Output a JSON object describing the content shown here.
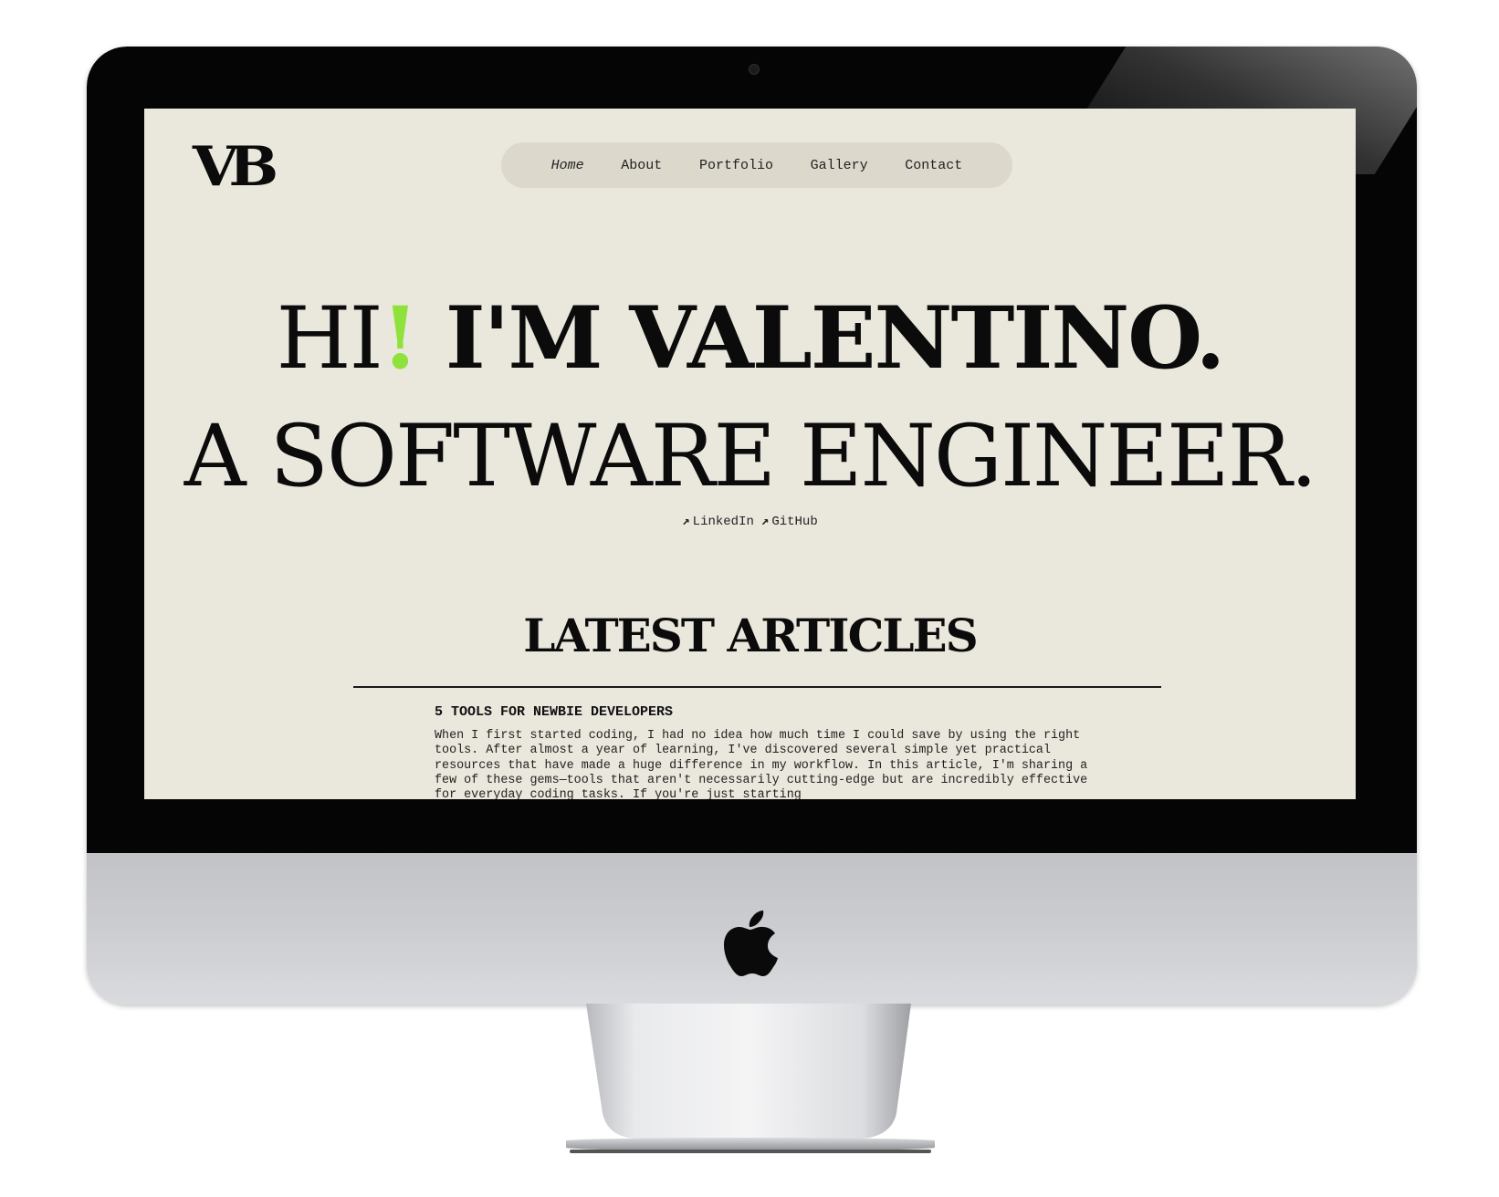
{
  "site": {
    "logo_text": "VB",
    "nav": {
      "items": [
        {
          "label": "Home",
          "active": true
        },
        {
          "label": "About",
          "active": false
        },
        {
          "label": "Portfolio",
          "active": false
        },
        {
          "label": "Gallery",
          "active": false
        },
        {
          "label": "Contact",
          "active": false
        }
      ]
    },
    "hero": {
      "line1_greeting": "HI",
      "line1_exclamation": "!",
      "line1_rest": " I'M VALENTINO.",
      "line2": "A SOFTWARE ENGINEER."
    },
    "social": {
      "arrow_glyph": "↗",
      "links": [
        {
          "label": "LinkedIn"
        },
        {
          "label": "GitHub"
        }
      ]
    },
    "articles": {
      "section_title": "LATEST ARTICLES",
      "items": [
        {
          "title": "5 TOOLS FOR NEWBIE DEVELOPERS",
          "excerpt": "When I first started coding, I had no idea how much time I could save by using the right tools. After almost a year of learning, I've discovered several simple yet practical resources that have made a huge difference in my workflow. In this article, I'm sharing a few of these gems—tools that aren't necessarily cutting-edge but are incredibly effective for everyday coding tasks. If you're just starting"
        }
      ]
    }
  },
  "colors": {
    "page_background": "#eae7dc",
    "nav_pill": "#dcd8cc",
    "accent": "#8fe23c",
    "ink": "#0b0b0b"
  },
  "device": {
    "brand_icon": "apple-logo-icon",
    "camera_icon": "camera-icon"
  }
}
